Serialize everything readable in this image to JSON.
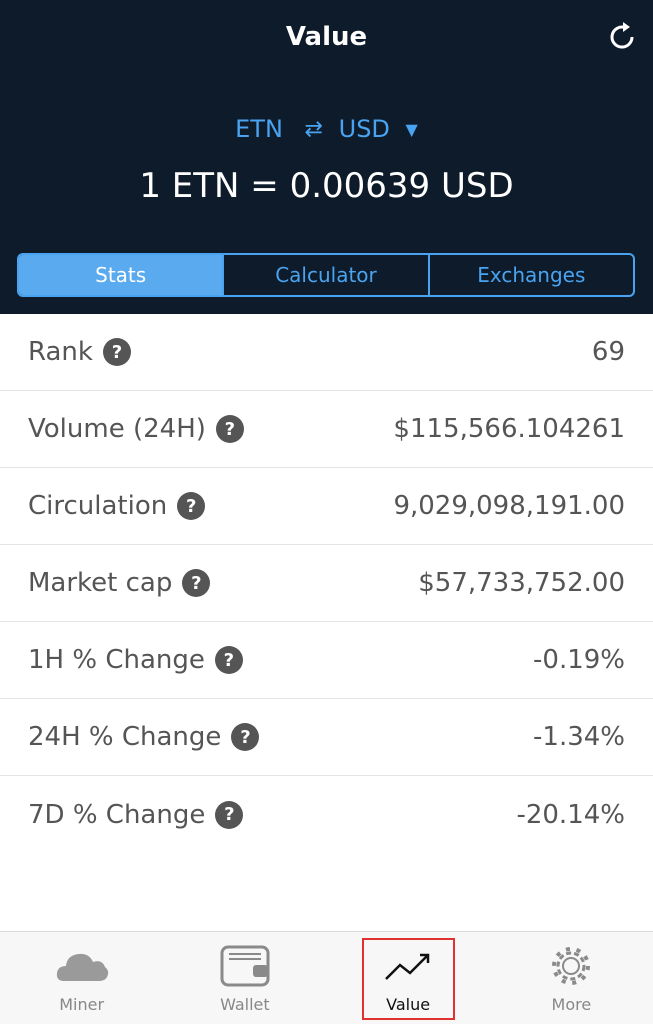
{
  "header": {
    "title": "Value",
    "refresh_icon": "refresh-icon",
    "from_currency": "ETN",
    "swap_icon": "⇄",
    "to_currency": "USD",
    "dropdown_icon": "▼",
    "rate": "1 ETN = 0.00639 USD"
  },
  "tabs": [
    {
      "label": "Stats",
      "active": true
    },
    {
      "label": "Calculator",
      "active": false
    },
    {
      "label": "Exchanges",
      "active": false
    }
  ],
  "stats": [
    {
      "label": "Rank",
      "value": "69"
    },
    {
      "label": "Volume (24H)",
      "value": "$115,566.104261"
    },
    {
      "label": "Circulation",
      "value": "9,029,098,191.00"
    },
    {
      "label": "Market cap",
      "value": "$57,733,752.00"
    },
    {
      "label": "1H % Change",
      "value": "-0.19%"
    },
    {
      "label": "24H % Change",
      "value": "-1.34%"
    },
    {
      "label": "7D % Change",
      "value": "-20.14%"
    }
  ],
  "help_glyph": "?",
  "tabbar": [
    {
      "label": "Miner",
      "icon": "cloud-icon"
    },
    {
      "label": "Wallet",
      "icon": "wallet-icon"
    },
    {
      "label": "Value",
      "icon": "trend-icon",
      "active": true
    },
    {
      "label": "More",
      "icon": "gear-icon"
    }
  ],
  "colors": {
    "header_bg": "#0d1b2a",
    "accent": "#4aa3f0",
    "highlight": "#e03030"
  }
}
